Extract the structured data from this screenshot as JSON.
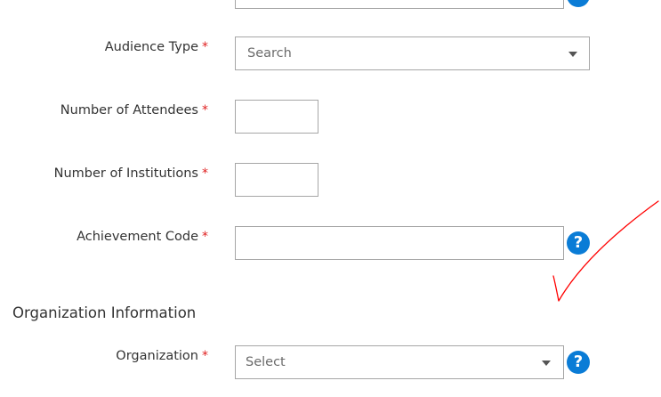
{
  "form": {
    "audience_type": {
      "label": "Audience Type",
      "required_mark": "*",
      "placeholder": "Search"
    },
    "attendees": {
      "label": "Number of Attendees",
      "required_mark": "*",
      "value": ""
    },
    "institutions": {
      "label": "Number of Institutions",
      "required_mark": "*",
      "value": ""
    },
    "achievement_code": {
      "label": "Achievement Code",
      "required_mark": "*",
      "value": "",
      "help_icon": "?"
    },
    "top_help_icon": "?"
  },
  "organization_section": {
    "title": "Organization Information",
    "organization": {
      "label": "Organization",
      "required_mark": "*",
      "placeholder": "Select",
      "help_icon": "?"
    }
  },
  "colors": {
    "required": "#e02020",
    "help_icon": "#0a7cd6",
    "annotation": "#ff0000",
    "border": "#a6a6a6"
  },
  "icons": [
    "help-icon",
    "dropdown-caret-icon",
    "checkmark-annotation"
  ]
}
